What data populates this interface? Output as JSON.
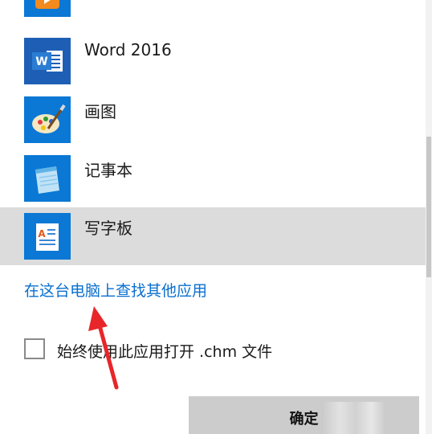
{
  "apps": [
    {
      "label": "",
      "icon": "media-player-icon"
    },
    {
      "label": "Word 2016",
      "icon": "word-icon"
    },
    {
      "label": "画图",
      "icon": "paint-icon"
    },
    {
      "label": "记事本",
      "icon": "notepad-icon"
    },
    {
      "label": "写字板",
      "icon": "wordpad-icon"
    }
  ],
  "more_apps_link": "在这台电脑上查找其他应用",
  "always_use": {
    "label": "始终使用此应用打开 .chm 文件",
    "checked": false
  },
  "ok_button": "确定",
  "colors": {
    "accent": "#0a78d4",
    "link": "#0a6fcf",
    "selected_row": "#dcdcdc",
    "button": "#cccccc",
    "arrow": "#e8262a"
  }
}
